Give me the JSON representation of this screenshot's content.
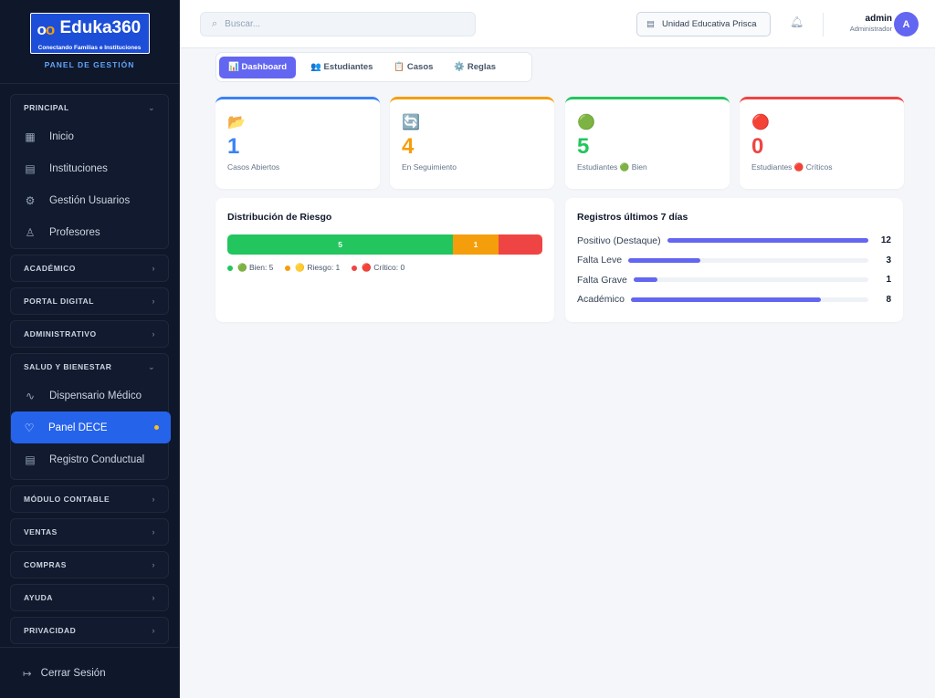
{
  "app": {
    "logo_brand": "Eduka360",
    "logo_tagline": "Conectando Familias e Instituciones",
    "panel_label": "PANEL DE GESTIÓN"
  },
  "sidebar": {
    "groups": [
      {
        "label": "PRINCIPAL",
        "expanded": true,
        "items": [
          {
            "label": "Inicio",
            "icon": "grid-icon"
          },
          {
            "label": "Instituciones",
            "icon": "building-icon"
          },
          {
            "label": "Gestión Usuarios",
            "icon": "gear-icon"
          },
          {
            "label": "Profesores",
            "icon": "user-icon"
          }
        ]
      },
      {
        "label": "ACADÉMICO",
        "expanded": false
      },
      {
        "label": "PORTAL DIGITAL",
        "expanded": false
      },
      {
        "label": "ADMINISTRATIVO",
        "expanded": false
      },
      {
        "label": "SALUD Y BIENESTAR",
        "expanded": true,
        "items": [
          {
            "label": "Dispensario Médico",
            "icon": "pulse-icon"
          },
          {
            "label": "Panel DECE",
            "icon": "heart-icon",
            "active": true
          },
          {
            "label": "Registro Conductual",
            "icon": "document-icon"
          }
        ]
      },
      {
        "label": "MÓDULO CONTABLE",
        "expanded": false
      },
      {
        "label": "VENTAS",
        "expanded": false
      },
      {
        "label": "COMPRAS",
        "expanded": false
      },
      {
        "label": "AYUDA",
        "expanded": false
      },
      {
        "label": "PRIVACIDAD",
        "expanded": false
      }
    ],
    "logout": "Cerrar Sesión"
  },
  "topbar": {
    "search_placeholder": "Buscar...",
    "institution": "Unidad Educativa Prisca",
    "user_name": "admin",
    "user_role": "Administrador",
    "avatar_initial": "A"
  },
  "tabs": [
    {
      "label": "📊 Dashboard",
      "active": true
    },
    {
      "label": "👥 Estudiantes"
    },
    {
      "label": "📋 Casos"
    },
    {
      "label": "⚙️ Reglas"
    }
  ],
  "stats": [
    {
      "emoji": "📂",
      "value": "1",
      "label": "Casos Abiertos",
      "color": "#3b82f6"
    },
    {
      "emoji": "🔄",
      "value": "4",
      "label": "En Seguimiento",
      "color": "#f59e0b"
    },
    {
      "emoji": "🟢",
      "value": "5",
      "label": "Estudiantes 🟢 Bien",
      "color": "#22c55e"
    },
    {
      "emoji": "🔴",
      "value": "0",
      "label": "Estudiantes 🔴 Críticos",
      "color": "#ef4444"
    }
  ],
  "risk": {
    "title": "Distribución de Riesgo",
    "segments": [
      {
        "value": 5,
        "label": "5",
        "color": "#22c55e"
      },
      {
        "value": 1,
        "label": "1",
        "color": "#f59e0b"
      },
      {
        "value": 0,
        "label": "",
        "color": "#ef4444"
      }
    ],
    "legend": [
      {
        "text": "🟢 Bien: 5",
        "color": "#22c55e"
      },
      {
        "text": "🟡 Riesgo: 1",
        "color": "#f59e0b"
      },
      {
        "text": "🔴 Crítico: 0",
        "color": "#ef4444"
      }
    ]
  },
  "registros": {
    "title": "Registros últimos 7 días",
    "rows": [
      {
        "name": "Positivo (Destaque)",
        "count": "12",
        "fraction": 1.0
      },
      {
        "name": "Falta Leve",
        "count": "3",
        "fraction": 0.3
      },
      {
        "name": "Falta Grave",
        "count": "1",
        "fraction": 0.1
      },
      {
        "name": "Académico",
        "count": "8",
        "fraction": 0.8
      }
    ]
  }
}
